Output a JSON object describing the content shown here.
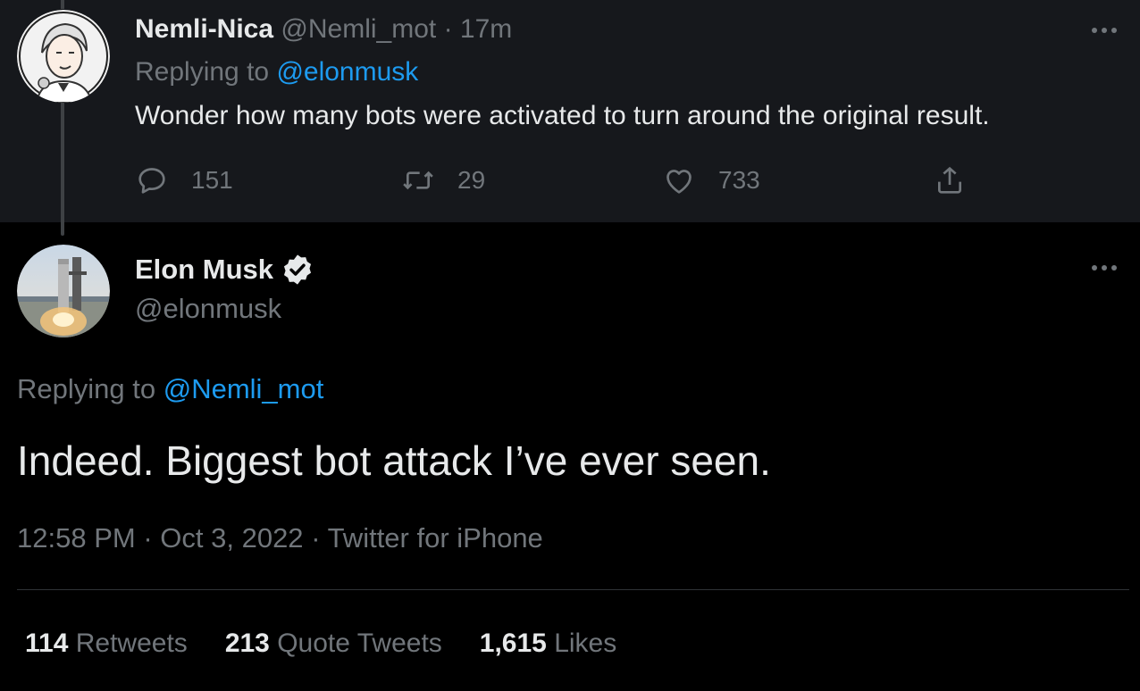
{
  "parent_tweet": {
    "display_name": "Nemli-Nica",
    "handle": "@Nemli_mot",
    "separator": "·",
    "time": "17m",
    "replying_prefix": "Replying to",
    "replying_to": "@elonmusk",
    "text": "Wonder how many bots were activated to turn around the original result.",
    "reply_count": "151",
    "retweet_count": "29",
    "like_count": "733",
    "avatar_icon": "cartoon-avatar-icon"
  },
  "main_tweet": {
    "display_name": "Elon Musk",
    "handle": "@elonmusk",
    "verified_icon": "verified-badge-icon",
    "replying_prefix": "Replying to",
    "replying_to": "@Nemli_mot",
    "text": "Indeed. Biggest bot attack I’ve ever seen.",
    "time": "12:58 PM",
    "date": "Oct 3, 2022",
    "source": "Twitter for iPhone",
    "separator": "·",
    "avatar_icon": "rocket-launch-avatar-icon"
  },
  "stats": [
    {
      "count": "114",
      "label": "Retweets"
    },
    {
      "count": "213",
      "label": "Quote Tweets"
    },
    {
      "count": "1,615",
      "label": "Likes"
    }
  ],
  "colors": {
    "background": "#000000",
    "parent_background": "#16181c",
    "text_primary": "#e7e9ea",
    "text_secondary": "#71767b",
    "link": "#1d9bf0"
  }
}
